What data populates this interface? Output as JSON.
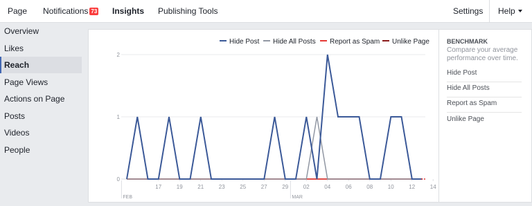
{
  "nav": {
    "tabs": [
      {
        "label": "Page"
      },
      {
        "label": "Notifications",
        "badge": "73"
      },
      {
        "label": "Insights"
      },
      {
        "label": "Publishing Tools"
      }
    ],
    "settings_label": "Settings",
    "help_label": "Help"
  },
  "sidebar": {
    "items": [
      {
        "label": "Overview"
      },
      {
        "label": "Likes"
      },
      {
        "label": "Reach"
      },
      {
        "label": "Page Views"
      },
      {
        "label": "Actions on Page"
      },
      {
        "label": "Posts"
      },
      {
        "label": "Videos"
      },
      {
        "label": "People"
      }
    ]
  },
  "benchmark": {
    "title": "BENCHMARK",
    "description": "Compare your average performance over time.",
    "items": [
      {
        "label": "Hide Post"
      },
      {
        "label": "Hide All Posts"
      },
      {
        "label": "Report as Spam"
      },
      {
        "label": "Unlike Page"
      }
    ]
  },
  "colors": {
    "hide_post": "#3b5998",
    "hide_all_posts": "#9197a3",
    "report_as_spam": "#e53935",
    "unlike_page": "#8b1a1a"
  },
  "chart_data": {
    "type": "line",
    "ylim": [
      0,
      2
    ],
    "yticks": [
      "0",
      "1",
      "2"
    ],
    "x": [
      "Feb 14",
      "Feb 15",
      "Feb 16",
      "Feb 17",
      "Feb 18",
      "Feb 19",
      "Feb 20",
      "Feb 21",
      "Feb 22",
      "Feb 23",
      "Feb 24",
      "Feb 25",
      "Feb 26",
      "Feb 27",
      "Feb 28",
      "Mar 01",
      "Mar 02",
      "Mar 03",
      "Mar 04",
      "Mar 05",
      "Mar 06",
      "Mar 07",
      "Mar 08",
      "Mar 09",
      "Mar 10",
      "Mar 11",
      "Mar 12",
      "Mar 13",
      "Mar 14"
    ],
    "xtick_labels": [
      {
        "index": 3,
        "label": "17"
      },
      {
        "index": 5,
        "label": "19"
      },
      {
        "index": 7,
        "label": "21"
      },
      {
        "index": 9,
        "label": "23"
      },
      {
        "index": 11,
        "label": "25"
      },
      {
        "index": 13,
        "label": "27"
      },
      {
        "index": 15,
        "label": "29"
      },
      {
        "index": 17,
        "label": "02"
      },
      {
        "index": 19,
        "label": "04"
      },
      {
        "index": 21,
        "label": "06"
      },
      {
        "index": 23,
        "label": "08"
      },
      {
        "index": 25,
        "label": "10"
      },
      {
        "index": 27,
        "label": "12"
      },
      {
        "index": 29,
        "label": "14"
      }
    ],
    "month_labels": [
      {
        "index": 0,
        "label": "FEB"
      },
      {
        "index": 16,
        "label": "MAR"
      }
    ],
    "series": [
      {
        "name": "Hide Post",
        "values": [
          0,
          1,
          0,
          0,
          1,
          0,
          0,
          1,
          0,
          0,
          0,
          0,
          0,
          0,
          1,
          0,
          0,
          1,
          0,
          2,
          1,
          1,
          1,
          0,
          0,
          1,
          1,
          0,
          0
        ]
      },
      {
        "name": "Hide All Posts",
        "values": [
          0,
          0,
          0,
          0,
          0,
          0,
          0,
          0,
          0,
          0,
          0,
          0,
          0,
          0,
          0,
          0,
          0,
          0,
          1,
          0,
          0,
          0,
          0,
          0,
          0,
          0,
          0,
          0,
          0
        ]
      },
      {
        "name": "Report as Spam",
        "values": [
          0,
          0,
          0,
          0,
          0,
          0,
          0,
          0,
          0,
          0,
          0,
          0,
          0,
          0,
          0,
          0,
          0,
          0,
          0,
          0,
          0,
          0,
          0,
          0,
          0,
          0,
          0,
          0,
          0
        ]
      },
      {
        "name": "Unlike Page",
        "values": [
          0,
          0,
          0,
          0,
          0,
          0,
          0,
          0,
          0,
          0,
          0,
          0,
          0,
          0,
          0,
          0,
          0,
          0,
          0,
          0,
          0,
          0,
          0,
          0,
          0,
          0,
          0,
          0,
          0
        ]
      }
    ]
  }
}
